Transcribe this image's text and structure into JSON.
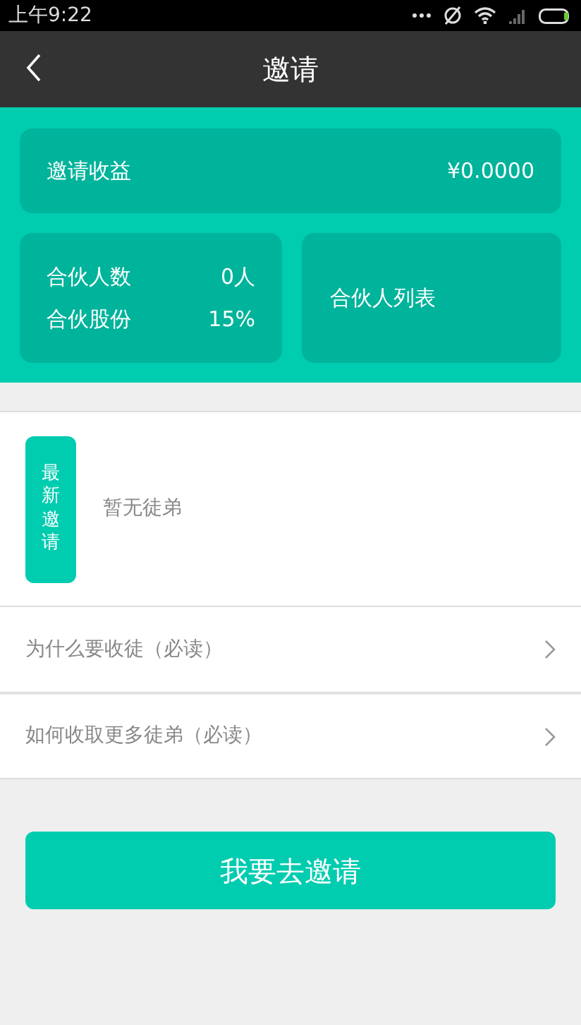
{
  "status_bar": {
    "time": "上午9:22"
  },
  "app_bar": {
    "title": "邀请"
  },
  "earnings": {
    "label": "邀请收益",
    "value": "¥0.0000"
  },
  "partner_stats": [
    {
      "label": "合伙人数",
      "value": "0人"
    },
    {
      "label": "合伙股份",
      "value": "15%"
    }
  ],
  "partner_list": {
    "label": "合伙人列表"
  },
  "latest_invites": {
    "tag": "最新邀请",
    "empty_text": "暂无徒弟"
  },
  "links": [
    {
      "label": "为什么要收徒（必读）"
    },
    {
      "label": "如何收取更多徒弟（必读）"
    }
  ],
  "invite_button": {
    "label": "我要去邀请"
  }
}
